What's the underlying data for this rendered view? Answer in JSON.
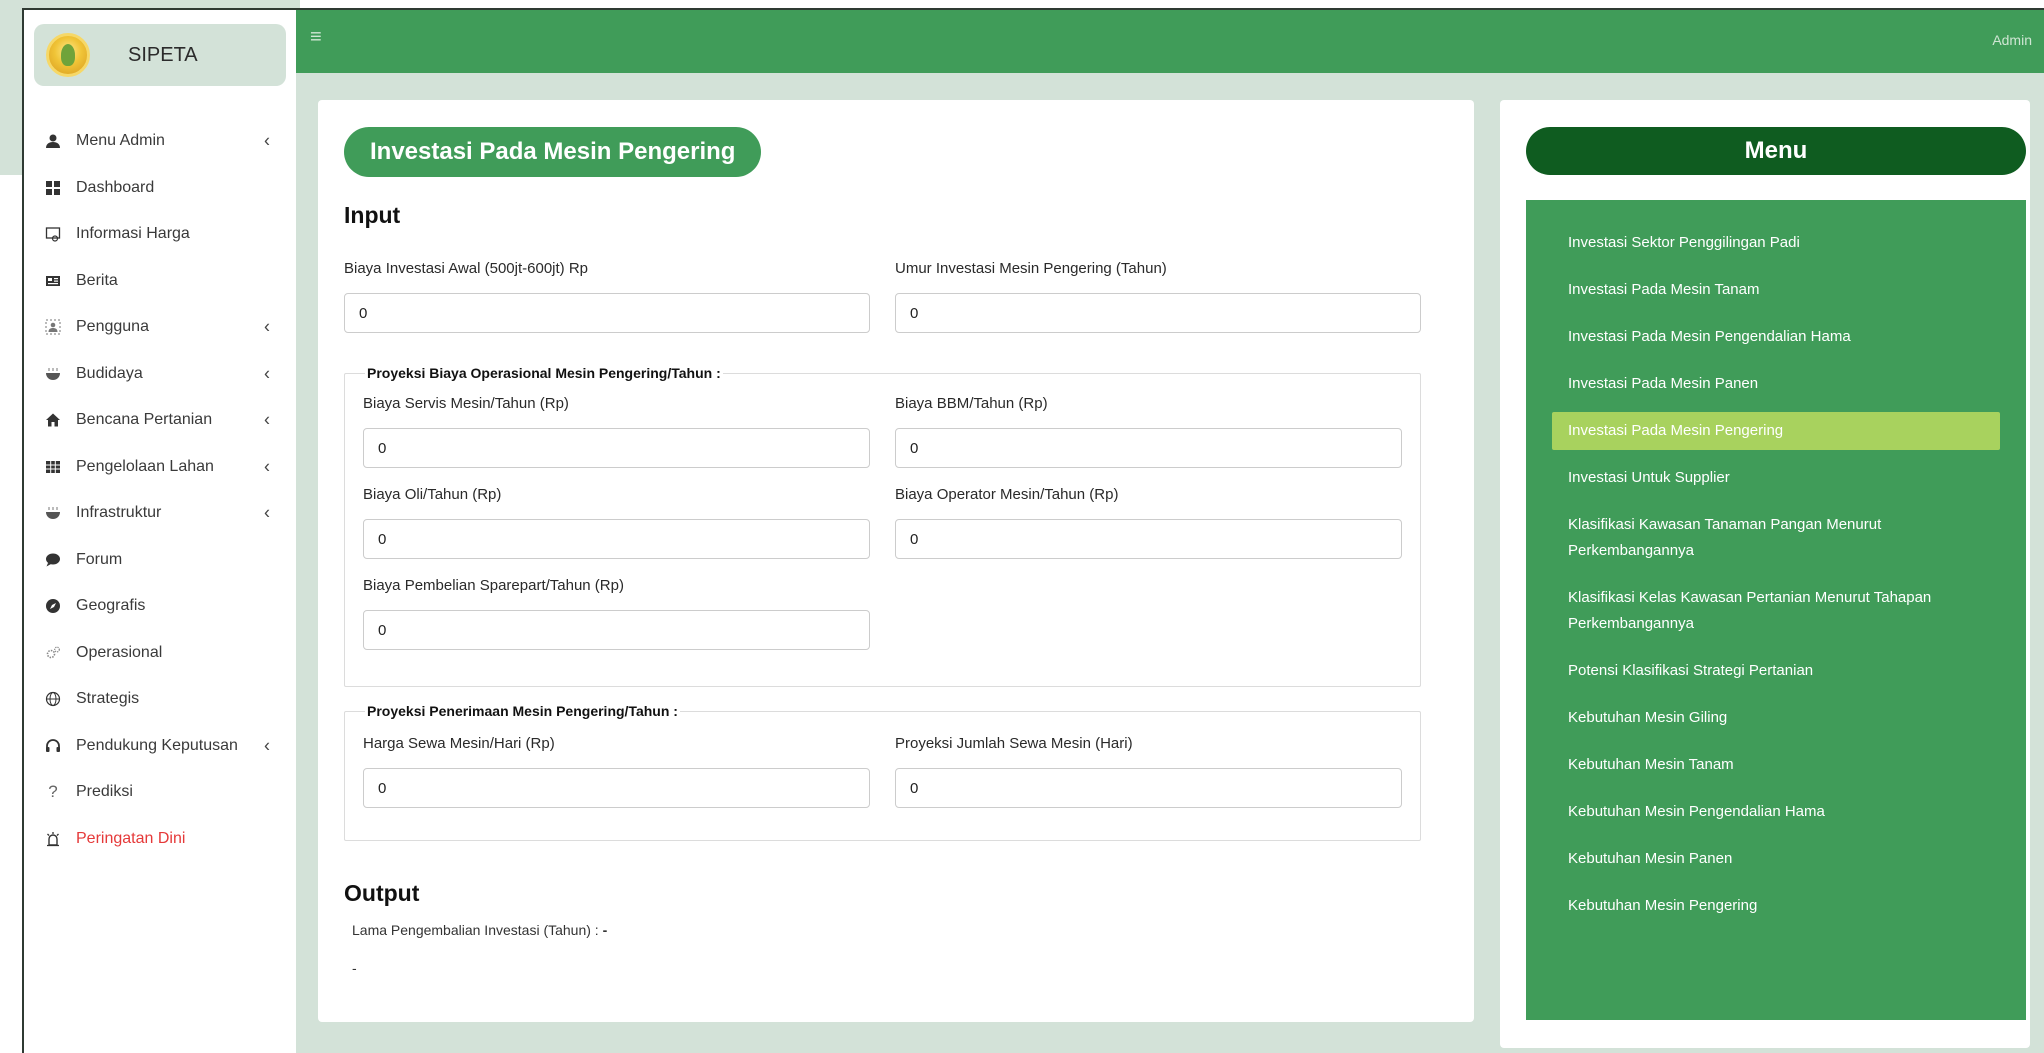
{
  "brand": {
    "name": "SIPETA"
  },
  "topbar": {
    "user": "Admin"
  },
  "sidebar": {
    "items": [
      {
        "label": "Menu Admin",
        "icon": "user-icon",
        "has_children": true
      },
      {
        "label": "Dashboard",
        "icon": "grid-icon",
        "has_children": false
      },
      {
        "label": "Informasi Harga",
        "icon": "price-tag-icon",
        "has_children": false
      },
      {
        "label": "Berita",
        "icon": "newspaper-icon",
        "has_children": false
      },
      {
        "label": "Pengguna",
        "icon": "users-icon",
        "has_children": true
      },
      {
        "label": "Budidaya",
        "icon": "bowl-icon",
        "has_children": true
      },
      {
        "label": "Bencana Pertanian",
        "icon": "home-icon",
        "has_children": true
      },
      {
        "label": "Pengelolaan Lahan",
        "icon": "table-icon",
        "has_children": true
      },
      {
        "label": "Infrastruktur",
        "icon": "bowl-icon",
        "has_children": true
      },
      {
        "label": "Forum",
        "icon": "chat-icon",
        "has_children": false
      },
      {
        "label": "Geografis",
        "icon": "compass-icon",
        "has_children": false
      },
      {
        "label": "Operasional",
        "icon": "gears-icon",
        "has_children": false
      },
      {
        "label": "Strategis",
        "icon": "globe-icon",
        "has_children": false
      },
      {
        "label": "Pendukung Keputusan",
        "icon": "headset-icon",
        "has_children": true
      },
      {
        "label": "Prediksi",
        "icon": "question-icon",
        "has_children": false
      },
      {
        "label": "Peringatan Dini",
        "icon": "alarm-icon",
        "has_children": false,
        "color": "#e53939"
      }
    ]
  },
  "form": {
    "title": "Investasi Pada Mesin Pengering",
    "input_heading": "Input",
    "fields": {
      "biaya_investasi_awal": {
        "label": "Biaya Investasi Awal (500jt-600jt) Rp",
        "value": "0"
      },
      "umur_investasi": {
        "label": "Umur Investasi Mesin Pengering (Tahun)",
        "value": "0"
      }
    },
    "operasional": {
      "legend": "Proyeksi Biaya Operasional Mesin Pengering/Tahun :",
      "servis": {
        "label": "Biaya Servis Mesin/Tahun (Rp)",
        "value": "0"
      },
      "bbm": {
        "label": "Biaya BBM/Tahun (Rp)",
        "value": "0"
      },
      "oli": {
        "label": "Biaya Oli/Tahun (Rp)",
        "value": "0"
      },
      "operator": {
        "label": "Biaya Operator Mesin/Tahun (Rp)",
        "value": "0"
      },
      "sparepart": {
        "label": "Biaya Pembelian Sparepart/Tahun (Rp)",
        "value": "0"
      }
    },
    "penerimaan": {
      "legend": "Proyeksi Penerimaan Mesin Pengering/Tahun :",
      "harga_sewa": {
        "label": "Harga Sewa Mesin/Hari (Rp)",
        "value": "0"
      },
      "jumlah_sewa": {
        "label": "Proyeksi Jumlah Sewa Mesin (Hari)",
        "value": "0"
      }
    },
    "output_heading": "Output",
    "output": {
      "label": "Lama Pengembalian Investasi (Tahun) :",
      "value": "-",
      "note": "-"
    }
  },
  "menu": {
    "title": "Menu",
    "items": [
      {
        "label": "Investasi Sektor Penggilingan Padi",
        "active": false
      },
      {
        "label": "Investasi Pada Mesin Tanam",
        "active": false
      },
      {
        "label": "Investasi Pada Mesin Pengendalian Hama",
        "active": false
      },
      {
        "label": "Investasi Pada Mesin Panen",
        "active": false
      },
      {
        "label": "Investasi Pada Mesin Pengering",
        "active": true
      },
      {
        "label": "Investasi Untuk Supplier",
        "active": false
      },
      {
        "label": "Klasifikasi Kawasan Tanaman Pangan Menurut Perkembangannya",
        "active": false
      },
      {
        "label": "Klasifikasi Kelas Kawasan Pertanian Menurut Tahapan Perkembangannya",
        "active": false
      },
      {
        "label": "Potensi Klasifikasi Strategi Pertanian",
        "active": false
      },
      {
        "label": "Kebutuhan Mesin Giling",
        "active": false
      },
      {
        "label": "Kebutuhan Mesin Tanam",
        "active": false
      },
      {
        "label": "Kebutuhan Mesin Pengendalian Hama",
        "active": false
      },
      {
        "label": "Kebutuhan Mesin Panen",
        "active": false
      },
      {
        "label": "Kebutuhan Mesin Pengering",
        "active": false
      }
    ]
  },
  "colors": {
    "primary": "#409c59",
    "dark": "#0f5c20",
    "active": "#a8d25e",
    "background": "#d3e2d8",
    "danger": "#e53939"
  }
}
